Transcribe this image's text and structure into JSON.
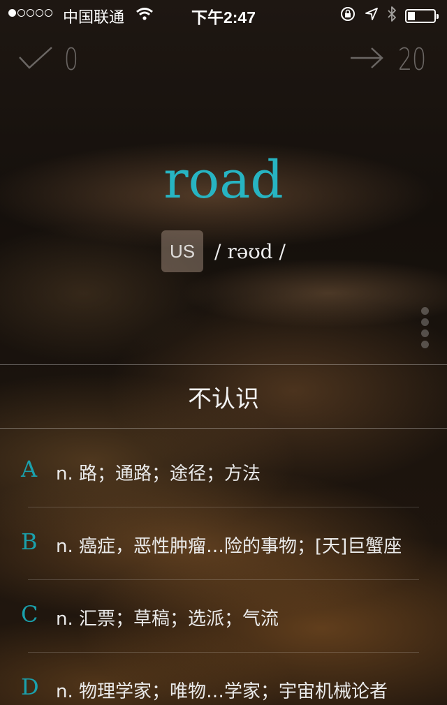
{
  "status_bar": {
    "carrier": "中国联通",
    "time": "下午2:47",
    "signal_bars_filled": 1,
    "signal_bars_total": 5
  },
  "counters": {
    "known_count": "0",
    "remaining_count": "20"
  },
  "word": {
    "text": "road",
    "accent_label": "US",
    "phonetic": "/ rəʊd /"
  },
  "dont_know_label": "不认识",
  "options": [
    {
      "letter": "A",
      "definition": "n. 路；通路；途径；方法"
    },
    {
      "letter": "B",
      "definition": "n. 癌症，恶性肿瘤…险的事物；[天]巨蟹座"
    },
    {
      "letter": "C",
      "definition": "n. 汇票；草稿；选派；气流"
    },
    {
      "letter": "D",
      "definition": "n. 物理学家；唯物…学家；宇宙机械论者"
    }
  ],
  "colors": {
    "accent": "#27b4c2",
    "option_letter": "#1aa1ad"
  }
}
